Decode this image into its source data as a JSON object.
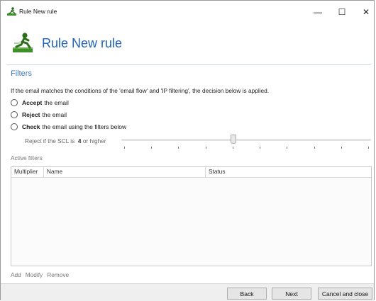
{
  "window": {
    "title": "Rule New rule",
    "icons": {
      "app": "rule-runner-icon",
      "minimize": "minimize-icon",
      "maximize": "maximize-icon",
      "close": "close-icon"
    },
    "controls": {
      "minimize": "—",
      "maximize": "☐",
      "close": "✕"
    }
  },
  "header": {
    "title": "Rule New rule"
  },
  "filters": {
    "section_title": "Filters",
    "description": "If the email matches the conditions of the 'email flow' and 'IP filtering', the decision below is applied.",
    "options": [
      {
        "bold": "Accept",
        "rest": "the email",
        "selected": false
      },
      {
        "bold": "Reject",
        "rest": "the email",
        "selected": false
      },
      {
        "bold": "Check",
        "rest": "the email using the filters below",
        "selected": false
      }
    ],
    "scl": {
      "prefix": "Reject if the SCL is",
      "value": "4",
      "suffix": "or higher",
      "level": 4,
      "min": 0,
      "max": 9
    }
  },
  "active_filters": {
    "label": "Active filters",
    "columns": [
      "Multiplier",
      "Name",
      "Status"
    ],
    "rows": []
  },
  "actions": {
    "add": "Add",
    "modify": "Modify",
    "remove": "Remove"
  },
  "footer": {
    "back": "Back",
    "next": "Next",
    "cancel": "Cancel and close"
  },
  "colors": {
    "accent": "#1f62b7",
    "section": "#3a78c4",
    "icon_green": "#3f8f2a"
  }
}
